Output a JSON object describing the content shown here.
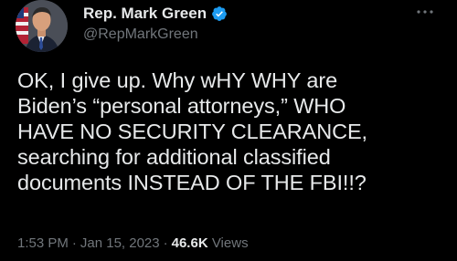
{
  "author": {
    "display_name": "Rep. Mark Green",
    "handle": "@RepMarkGreen",
    "verified_icon": "verified-badge-icon",
    "avatar_icon": "avatar-portrait"
  },
  "more_icon": "more-dots-icon",
  "tweet": {
    "text": "OK, I give up. Why wHY WHY are\nBiden’s “personal attorneys,” WHO\nHAVE NO SECURITY CLEARANCE,\nsearching for additional classified\ndocuments INSTEAD OF THE FBI!!?"
  },
  "meta": {
    "time": "1:53 PM",
    "separator": "·",
    "date": "Jan 15, 2023",
    "views_count": "46.6K",
    "views_label": "Views"
  },
  "colors": {
    "background": "#000000",
    "text_primary": "#e7e9ea",
    "text_secondary": "#71767b",
    "verified": "#1d9bf0"
  }
}
